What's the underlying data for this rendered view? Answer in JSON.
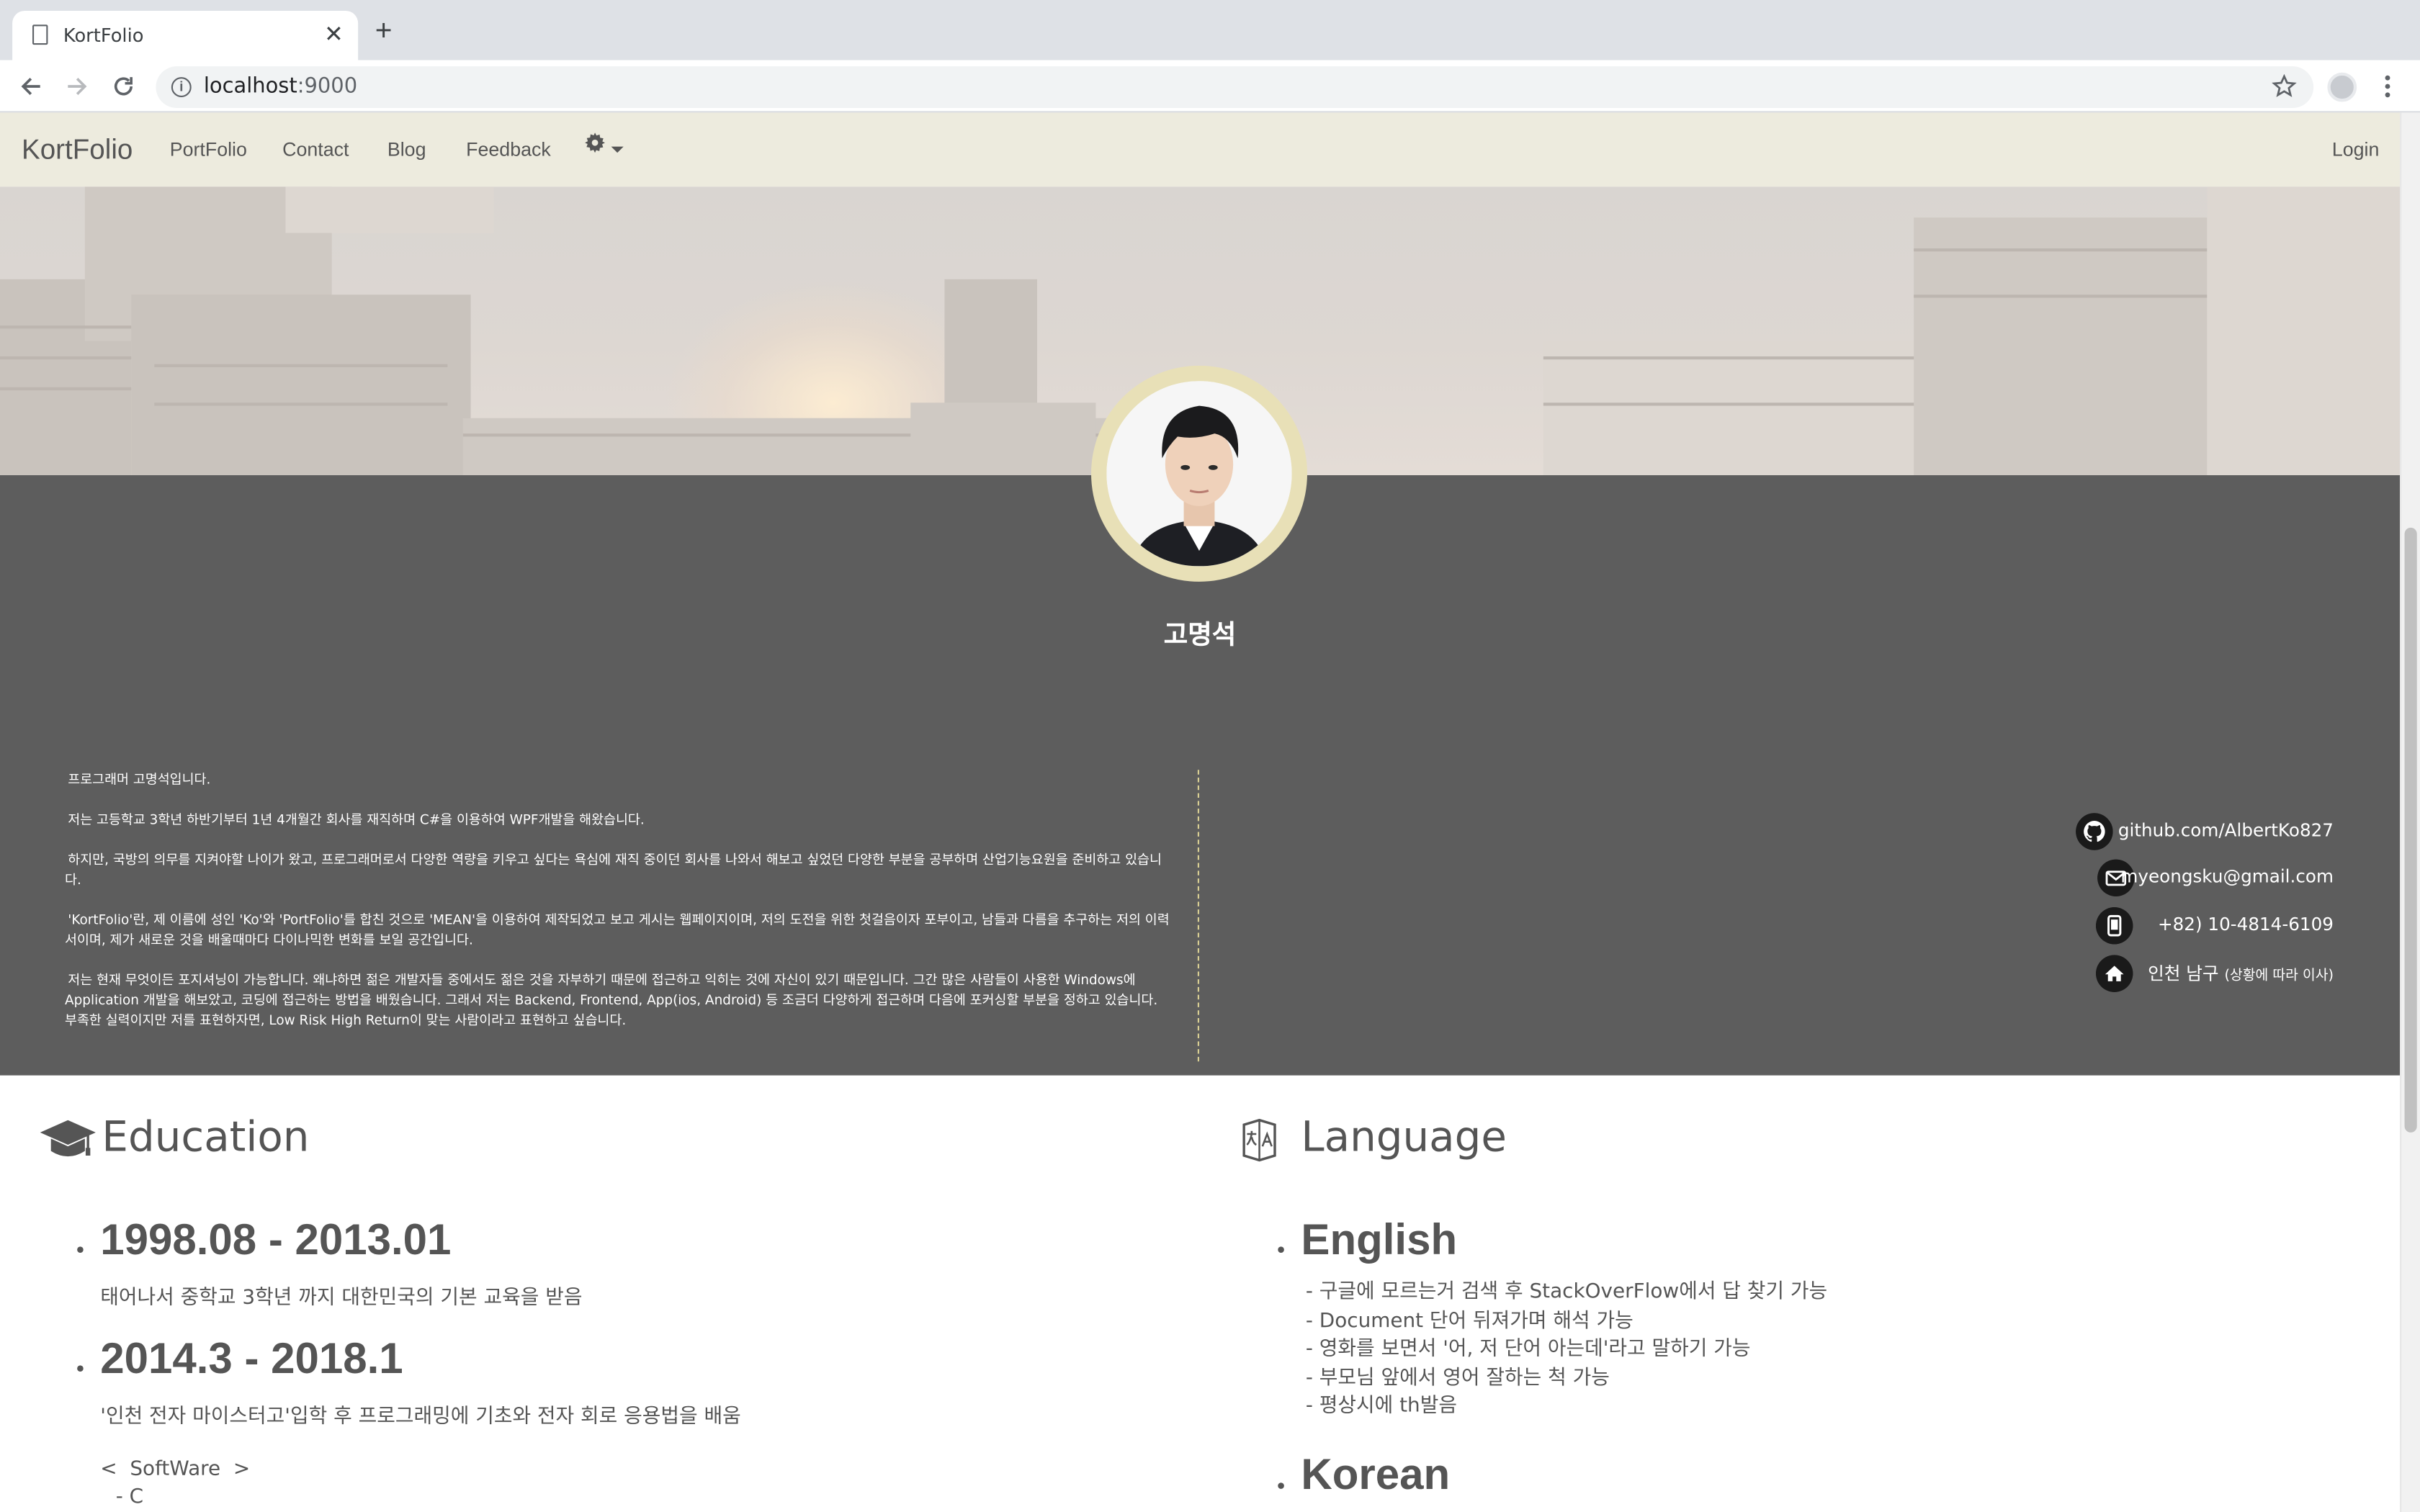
{
  "browser": {
    "tab_title": "KortFolio",
    "url_host": "localhost",
    "url_port": ":9000",
    "new_tab_glyph": "+",
    "close_glyph": "✕"
  },
  "nav": {
    "brand": "KortFolio",
    "links": [
      "PortFolio",
      "Contact",
      "Blog",
      "Feedback"
    ],
    "login": "Login"
  },
  "profile": {
    "name": "고명석"
  },
  "bio": [
    "프로그래머 고명석입니다.",
    "저는 고등학교 3학년 하반기부터 1년 4개월간 회사를 재직하며 C#을 이용하여 WPF개발을 해왔습니다.",
    "하지만, 국방의 의무를 지켜야할 나이가 왔고, 프로그래머로서 다양한 역량을 키우고 싶다는 욕심에 재직 중이던 회사를 나와서 해보고 싶었던 다양한 부분을 공부하며 산업기능요원을 준비하고 있습니다.",
    "'KortFolio'란, 제 이름에 성인 'Ko'와 'PortFolio'를 합친 것으로 'MEAN'을 이용하여 제작되었고 보고 게시는 웹페이지이며, 저의 도전을 위한 첫걸음이자 포부이고, 남들과 다름을 추구하는 저의 이력서이며, 제가 새로운 것을 배울때마다 다이나믹한 변화를 보일 공간입니다.",
    "저는 현재 무엇이든 포지셔닝이 가능합니다. 왜냐하면 젊은 개발자들 중에서도 젊은 것을 자부하기 때문에 접근하고 익히는 것에 자신이 있기 때문입니다. 그간 많은 사람들이 사용한 Windows에 Application 개발을 해보았고, 코딩에 접근하는 방법을 배웠습니다. 그래서 저는 Backend, Frontend, App(ios, Android) 등 조금더 다양하게 접근하며 다음에 포커싱할 부분을 정하고 있습니다. 부족한 실력이지만 저를 표현하자면, Low Risk High Return이 맞는 사람이라고 표현하고 싶습니다."
  ],
  "contacts": {
    "github": "github.com/AlbertKo827",
    "email": "myeongsku@gmail.com",
    "phone": "+82) 10-4814-6109",
    "address": "인천 남구",
    "address_note": "(상황에 따라 이사)"
  },
  "education": {
    "heading": "Education",
    "items": [
      {
        "period": "1998.08 - 2013.01",
        "desc": "태어나서 중학교 3학년 까지 대한민국의 기본 교육을 받음"
      },
      {
        "period": "2014.3 - 2018.1",
        "desc": "'인천 전자 마이스터고'입학 후 프로그래밍에 기초와 전자 회로 응용법을 배움"
      }
    ],
    "software_label": "<  SoftWare  >",
    "software_first": "- C"
  },
  "language": {
    "heading": "Language",
    "items": [
      {
        "name": "English",
        "points": [
          "- 구글에 모르는거 검색 후 StackOverFlow에서 답 찾기 가능",
          "- Document 단어 뒤져가며 해석 가능",
          "- 영화를 보면서 '어, 저 단어 아는데'라고 말하기 가능",
          "- 부모님 앞에서 영어 잘하는 척 가능",
          "- 평상시에 th발음"
        ]
      },
      {
        "name": "Korean",
        "points": []
      }
    ]
  },
  "icons": {
    "browser": [
      "document-icon",
      "close-icon",
      "new-tab-icon",
      "back-icon",
      "forward-icon",
      "reload-icon",
      "info-icon",
      "bookmark-star-icon",
      "profile-avatar-icon",
      "menu-kebab-icon"
    ],
    "site": [
      "gear-icon",
      "caret-down-icon",
      "github-icon",
      "mail-icon",
      "phone-icon",
      "home-icon",
      "graduation-cap-icon",
      "translate-icon"
    ]
  },
  "colors": {
    "nav_bg": "#edebde",
    "panel_bg": "#5d5d5d",
    "avatar_ring": "#e8e0b7",
    "divider": "#d9cf94",
    "text": "#555555"
  }
}
